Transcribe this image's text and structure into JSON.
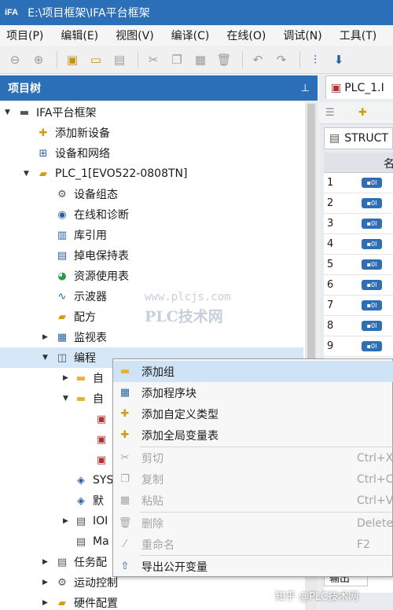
{
  "window": {
    "logo": "iFA",
    "title": "E:\\项目框架\\IFA平台框架"
  },
  "menu": [
    "项目(P)",
    "编辑(E)",
    "视图(V)",
    "编译(C)",
    "在线(O)",
    "调试(N)",
    "工具(T)"
  ],
  "panel": {
    "title": "项目树",
    "pin": "⊥"
  },
  "tree": {
    "root": "IFA平台框架",
    "add_device": "添加新设备",
    "devices_network": "设备和网络",
    "plc": "PLC_1[EVO522-0808TN]",
    "device_config": "设备组态",
    "online_diag": "在线和诊断",
    "library": "库引用",
    "retain_table": "掉电保持表",
    "resource_table": "资源使用表",
    "oscilloscope": "示波器",
    "recipe": "配方",
    "watch_table": "监视表",
    "programming": "编程",
    "folder1": "自",
    "folder2": "自",
    "sys": "SYS",
    "default": "默",
    "io": "IOI",
    "main": "Ma",
    "task_config": "任务配",
    "motion": "运动控制",
    "hw_config": "硬件配置"
  },
  "editor": {
    "tab": "PLC_1.I",
    "struct": "STRUCT",
    "column_header": "名",
    "rows": [
      "1",
      "2",
      "3",
      "4",
      "5",
      "6",
      "7",
      "8",
      "9"
    ],
    "badge": "▪0I",
    "bottom_tab": "输出"
  },
  "watermark": {
    "url": "www.plcjs.com",
    "name": "PLC技术网"
  },
  "credit": "知乎 @PLC技术网",
  "context_menu": {
    "add_group": "添加组",
    "add_block": "添加程序块",
    "add_type": "添加自定义类型",
    "add_global": "添加全局变量表",
    "cut": "剪切",
    "cut_sc": "Ctrl+X",
    "copy": "复制",
    "copy_sc": "Ctrl+C",
    "paste": "粘贴",
    "paste_sc": "Ctrl+V",
    "delete": "删除",
    "delete_sc": "Delete",
    "rename": "重命名",
    "rename_sc": "F2",
    "export": "导出公开变量"
  },
  "colors": {
    "accent": "#2b6fb8",
    "folder": "#e8b030",
    "selection": "#d6e8f7"
  }
}
